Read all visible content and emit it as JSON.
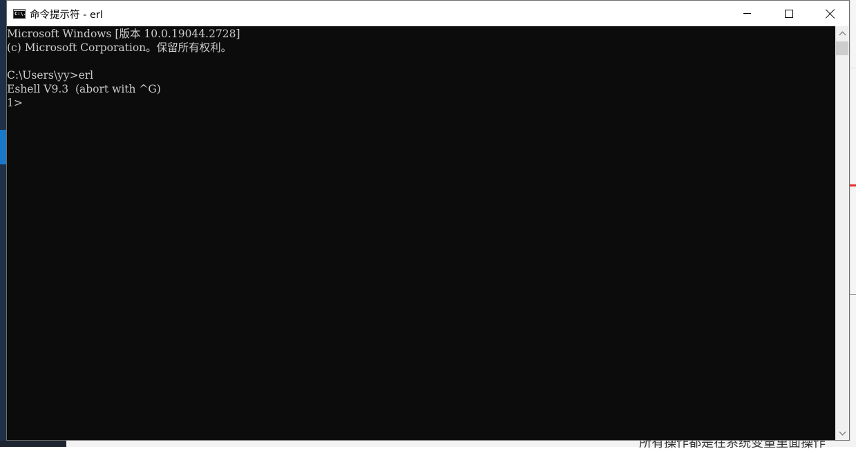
{
  "window": {
    "title": "命令提示符 - erl",
    "icon": "cmd-icon",
    "icon_text": "C:\\."
  },
  "console": {
    "lines": [
      "Microsoft Windows [版本 10.0.19044.2728]",
      "(c) Microsoft Corporation。保留所有权利。",
      "",
      "C:\\Users\\yy>erl",
      "Eshell V9.3  (abort with ^G)",
      "1>"
    ],
    "text_color": "#cccccc",
    "background": "#0c0c0c"
  },
  "background": {
    "bottom_text": "所有操作都是在系统变量里面操作"
  }
}
